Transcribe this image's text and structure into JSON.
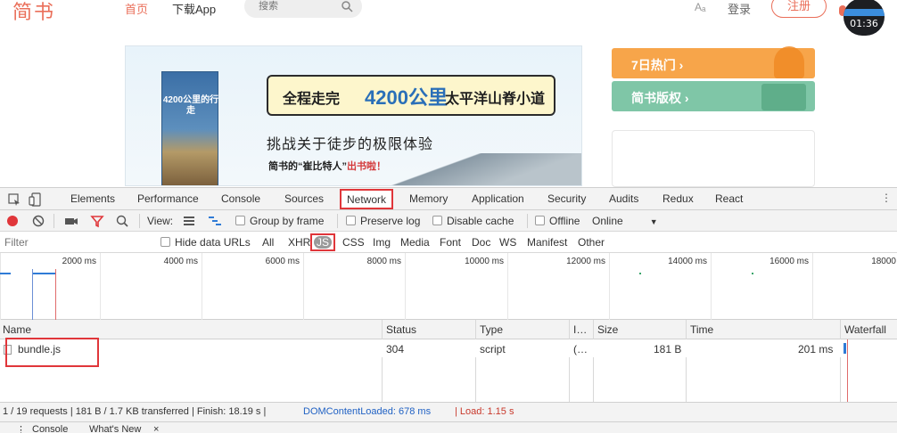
{
  "site": {
    "logo": "简书",
    "nav_home": "首页",
    "nav_app": "下载App",
    "search_placeholder": "搜索",
    "aa": "Aₐ",
    "login": "登录",
    "register": "注册",
    "video_time": "01:36"
  },
  "banner": {
    "book_title": "4200公里的行走",
    "headline_a": "全程走完",
    "headline_b": "4200公里",
    "headline_c": "太平洋山脊小道",
    "subhead": "挑战关于徒步的极限体验",
    "pub_a": "简书的“崔比特人”",
    "pub_b": "出书啦！"
  },
  "sidebar": {
    "hot": "7日热门 ›",
    "copyright": "简书版权 ›"
  },
  "devtools": {
    "tabs": [
      "Elements",
      "Performance",
      "Console",
      "Sources",
      "Network",
      "Memory",
      "Application",
      "Security",
      "Audits",
      "Redux",
      "React"
    ],
    "active_tab": "Network",
    "toolbar": {
      "view_label": "View:",
      "group_by_frame": "Group by frame",
      "preserve_log": "Preserve log",
      "disable_cache": "Disable cache",
      "offline": "Offline",
      "throttle": "Online"
    },
    "filter": {
      "placeholder": "Filter",
      "hide_data_urls": "Hide data URLs",
      "types": [
        "All",
        "XHR",
        "JS",
        "CSS",
        "Img",
        "Media",
        "Font",
        "Doc",
        "WS",
        "Manifest",
        "Other"
      ],
      "active_type": "JS"
    },
    "timeline_ticks": [
      "2000 ms",
      "4000 ms",
      "6000 ms",
      "8000 ms",
      "10000 ms",
      "12000 ms",
      "14000 ms",
      "16000 ms",
      "18000"
    ],
    "columns": [
      "Name",
      "Status",
      "Type",
      "I…",
      "Size",
      "Time",
      "Waterfall"
    ],
    "rows": [
      {
        "name": "bundle.js",
        "status": "304",
        "type": "script",
        "initiator": "(…",
        "size": "181 B",
        "time": "201 ms"
      }
    ],
    "status": {
      "summary": "1 / 19 requests | 181 B / 1.7 KB transferred | Finish: 18.19 s |",
      "dcl": "DOMContentLoaded: 678 ms",
      "load": "| Load: 1.15 s"
    },
    "drawer_tabs": [
      "Console",
      "What's New",
      "×"
    ]
  },
  "colors": {
    "brand": "#ea6f5a",
    "highlight": "#e0363a",
    "dcl": "#2162c4",
    "load": "#c8382b"
  }
}
